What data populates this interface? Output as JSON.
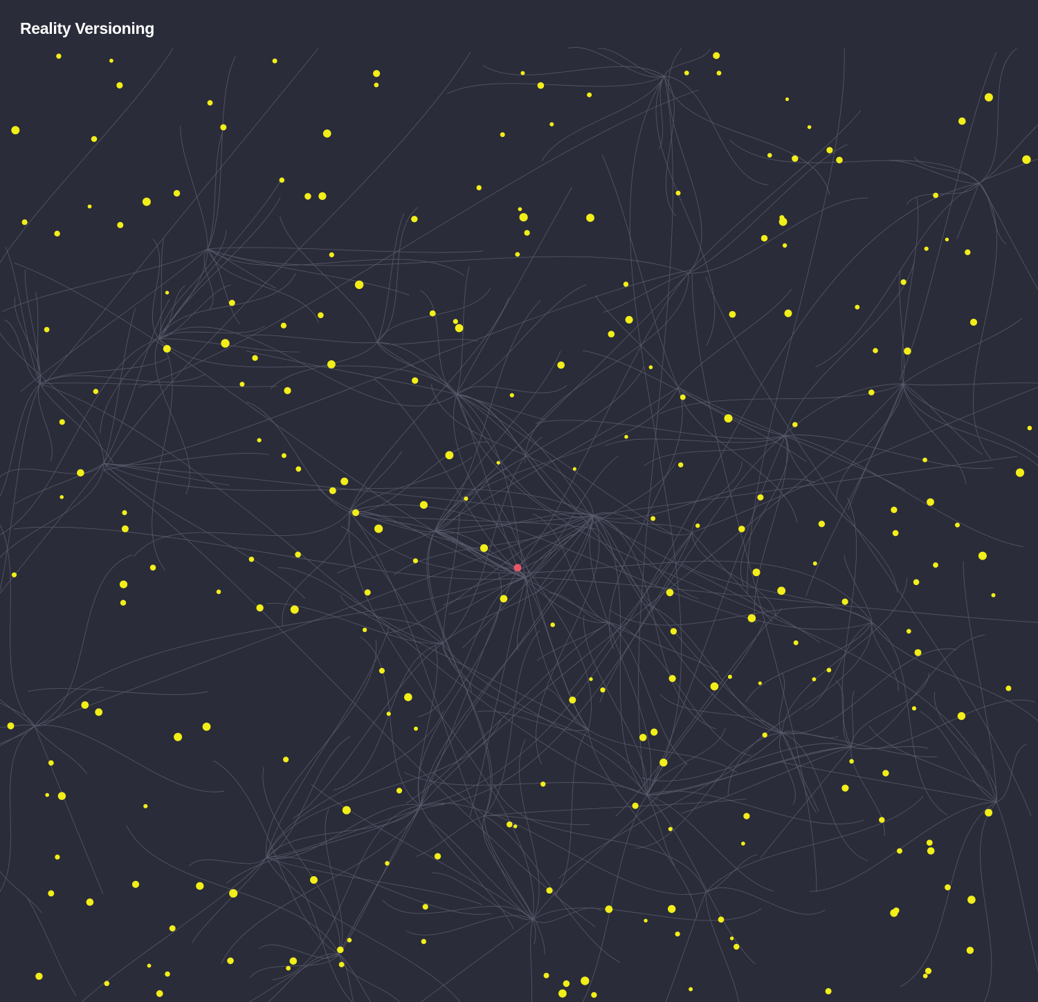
{
  "title": "Reality Versioning",
  "colors": {
    "background": "#2a2c39",
    "edge": "#5b5d6e",
    "node": "#f2ee19",
    "root_node": "#e8566a",
    "title": "#ffffff"
  },
  "graph": {
    "root": "origin",
    "node_count": 240
  }
}
